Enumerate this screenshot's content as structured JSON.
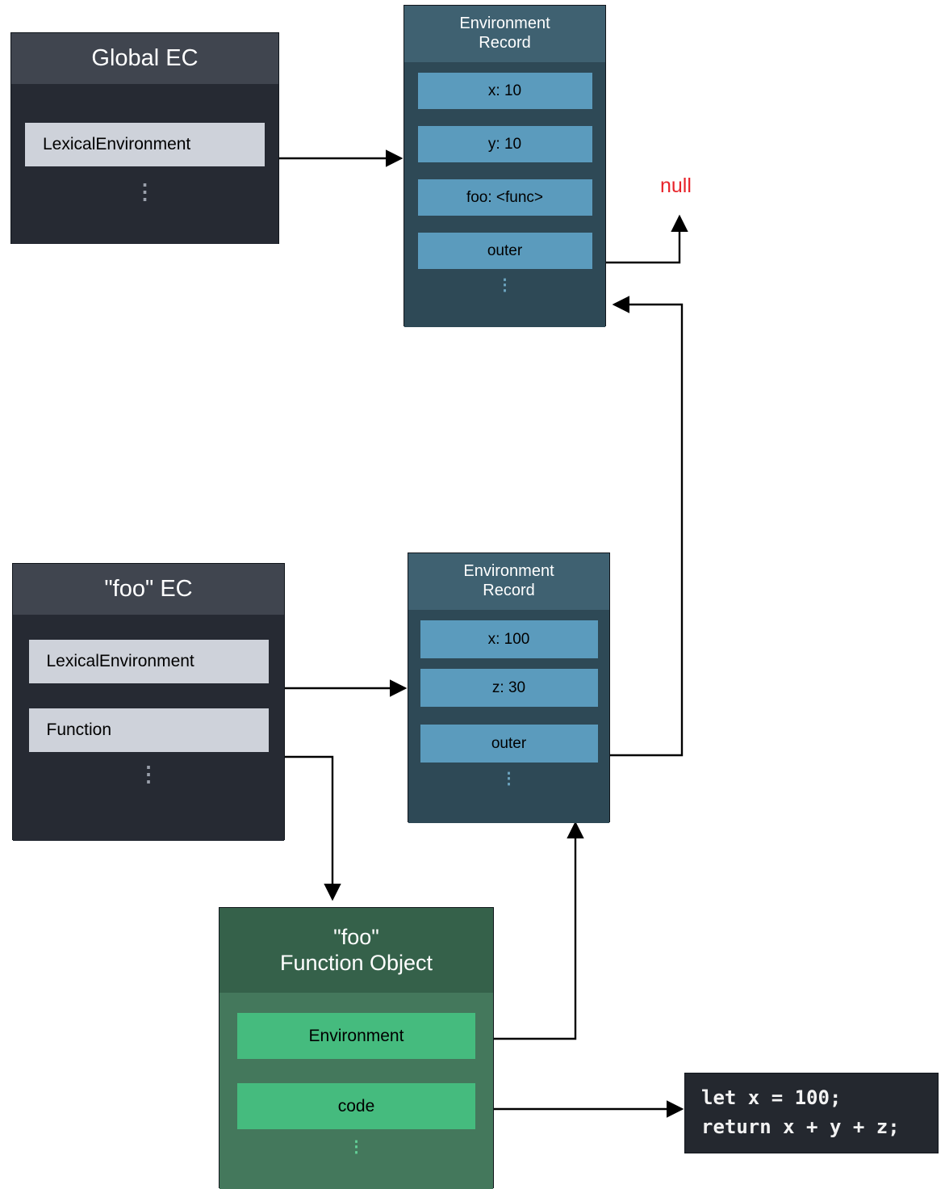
{
  "diagram": {
    "title": "JavaScript closure scope chain diagram",
    "colors": {
      "ec_header": "#40454f",
      "ec_body": "#262a33",
      "ec_slot": "#ced2da",
      "er_header": "#3f6171",
      "er_body": "#2e4956",
      "er_slot": "#5b9bbd",
      "fo_header": "#35614a",
      "fo_body": "#44785c",
      "fo_slot": "#45bb7e",
      "code_bg": "#24282f",
      "null_text": "#e8232a",
      "connector": "#000000"
    },
    "ellipsis": "⋮"
  },
  "global_ec": {
    "title": "Global EC",
    "slots": [
      {
        "label": "LexicalEnvironment"
      }
    ]
  },
  "global_env_record": {
    "title": "Environment\nRecord",
    "slots": [
      {
        "label": "x: 10"
      },
      {
        "label": "y: 10"
      },
      {
        "label": "foo: <func>"
      },
      {
        "label": "outer"
      }
    ]
  },
  "foo_ec": {
    "title": "\"foo\" EC",
    "slots": [
      {
        "label": "LexicalEnvironment"
      },
      {
        "label": "Function"
      }
    ]
  },
  "foo_env_record": {
    "title": "Environment\nRecord",
    "slots": [
      {
        "label": "x: 100"
      },
      {
        "label": "z: 30"
      },
      {
        "label": "outer"
      }
    ]
  },
  "foo_function_object": {
    "title": "\"foo\"\nFunction Object",
    "slots": [
      {
        "label": "Environment"
      },
      {
        "label": "code"
      }
    ]
  },
  "code_box": {
    "text": "let x = 100;\nreturn x + y + z;"
  },
  "labels": {
    "null": "null"
  }
}
